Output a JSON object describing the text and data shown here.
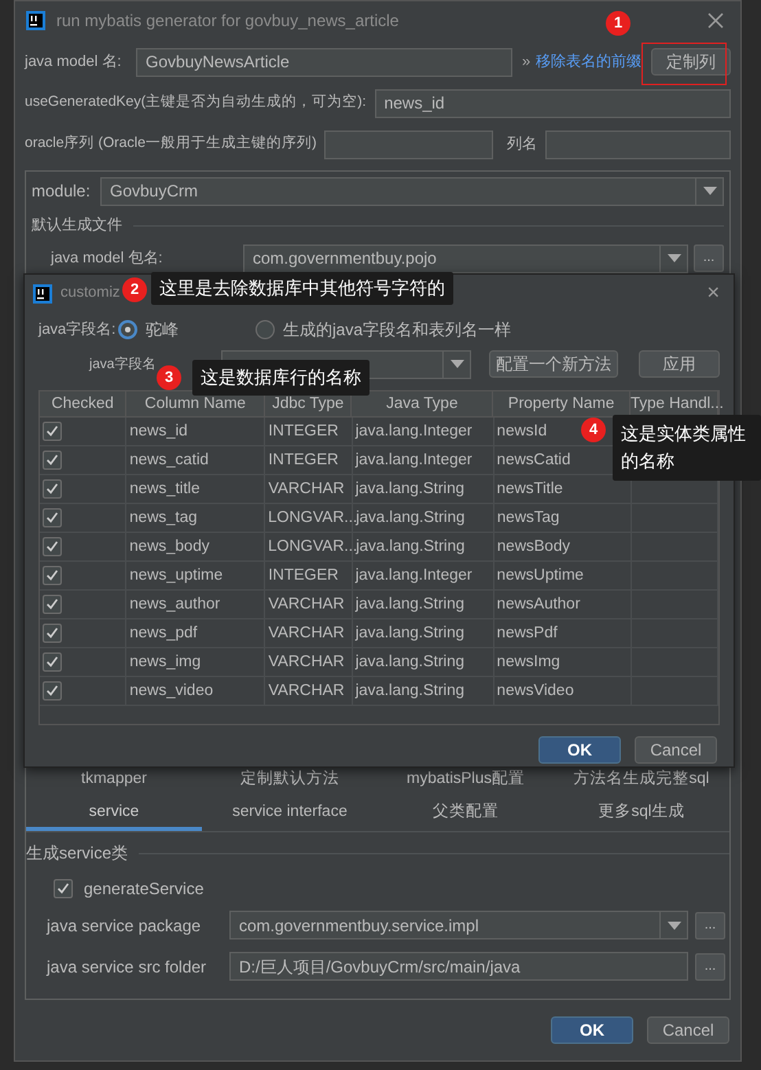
{
  "window": {
    "title": "run mybatis generator for govbuy_news_article"
  },
  "model_name": {
    "label": "java model 名:",
    "value": "GovbuyNewsArticle"
  },
  "remove_prefix_link": {
    "arrow": "»",
    "label": "移除表名的前缀"
  },
  "customize_button": "定制列",
  "use_generated_key": {
    "label": "useGeneratedKey(主键是否为自动生成的，可为空):",
    "value": "news_id"
  },
  "oracle_sequence": {
    "label": "oracle序列 (Oracle一般用于生成主键的序列)",
    "column_label": "列名"
  },
  "module": {
    "label": "module:",
    "value": "GovbuyCrm"
  },
  "default_files": {
    "title": "默认生成文件",
    "model_package": {
      "label": "java model 包名:",
      "value": "com.governmentbuy.pojo",
      "browse": "..."
    }
  },
  "customize_dialog": {
    "title": "customiz",
    "close": "×",
    "field_name_label": "java字段名:",
    "options": [
      {
        "label": "驼峰",
        "selected": true
      },
      {
        "label": "生成的java字段名和表列名一样",
        "selected": false
      }
    ],
    "rule_label": "java字段名",
    "buttons": [
      "配置一个新方法",
      "应用"
    ],
    "table": {
      "columns": [
        "Checked",
        "Column Name",
        "Jdbc Type",
        "Java Type",
        "Property Name",
        "Type Handl..."
      ],
      "rows": [
        {
          "checked": true,
          "column_name": "news_id",
          "jdbc_type": "INTEGER",
          "java_type": "java.lang.Integer",
          "property_name": "newsId"
        },
        {
          "checked": true,
          "column_name": "news_catid",
          "jdbc_type": "INTEGER",
          "java_type": "java.lang.Integer",
          "property_name": "newsCatid"
        },
        {
          "checked": true,
          "column_name": "news_title",
          "jdbc_type": "VARCHAR",
          "java_type": "java.lang.String",
          "property_name": "newsTitle"
        },
        {
          "checked": true,
          "column_name": "news_tag",
          "jdbc_type": "LONGVAR...",
          "java_type": "java.lang.String",
          "property_name": "newsTag"
        },
        {
          "checked": true,
          "column_name": "news_body",
          "jdbc_type": "LONGVAR...",
          "java_type": "java.lang.String",
          "property_name": "newsBody"
        },
        {
          "checked": true,
          "column_name": "news_uptime",
          "jdbc_type": "INTEGER",
          "java_type": "java.lang.Integer",
          "property_name": "newsUptime"
        },
        {
          "checked": true,
          "column_name": "news_author",
          "jdbc_type": "VARCHAR",
          "java_type": "java.lang.String",
          "property_name": "newsAuthor"
        },
        {
          "checked": true,
          "column_name": "news_pdf",
          "jdbc_type": "VARCHAR",
          "java_type": "java.lang.String",
          "property_name": "newsPdf"
        },
        {
          "checked": true,
          "column_name": "news_img",
          "jdbc_type": "VARCHAR",
          "java_type": "java.lang.String",
          "property_name": "newsImg"
        },
        {
          "checked": true,
          "column_name": "news_video",
          "jdbc_type": "VARCHAR",
          "java_type": "java.lang.String",
          "property_name": "newsVideo"
        }
      ]
    },
    "ok": "OK",
    "cancel": "Cancel"
  },
  "tab_rows": [
    {
      "tabs": [
        {
          "label": "tkmapper",
          "selected": false
        },
        {
          "label": "定制默认方法",
          "selected": false
        },
        {
          "label": "mybatisPlus配置",
          "selected": false
        },
        {
          "label": "方法名生成完整sql",
          "selected": false
        }
      ]
    },
    {
      "tabs": [
        {
          "label": "service",
          "selected": true
        },
        {
          "label": "service interface",
          "selected": false
        },
        {
          "label": "父类配置",
          "selected": false
        },
        {
          "label": "更多sql生成",
          "selected": false
        }
      ]
    }
  ],
  "service_group": {
    "title": "生成service类",
    "generate_service": {
      "label": "generateService",
      "checked": true
    },
    "package": {
      "label": "java service package",
      "value": "com.governmentbuy.service.impl",
      "browse": "..."
    },
    "src_folder": {
      "label": "java service src folder",
      "value": "D:/巨人项目/GovbuyCrm/src/main/java",
      "browse": "..."
    }
  },
  "buttons": {
    "ok": "OK",
    "cancel": "Cancel"
  },
  "annotations": [
    {
      "number": "1",
      "kind": "highlight"
    },
    {
      "number": "2",
      "kind": "callout",
      "text": "这里是去除数据库中其他符号字符的"
    },
    {
      "number": "3",
      "kind": "callout",
      "text": "这是数据库行的名称"
    },
    {
      "number": "4",
      "kind": "callout",
      "text": "这是实体类属性的名称"
    }
  ]
}
